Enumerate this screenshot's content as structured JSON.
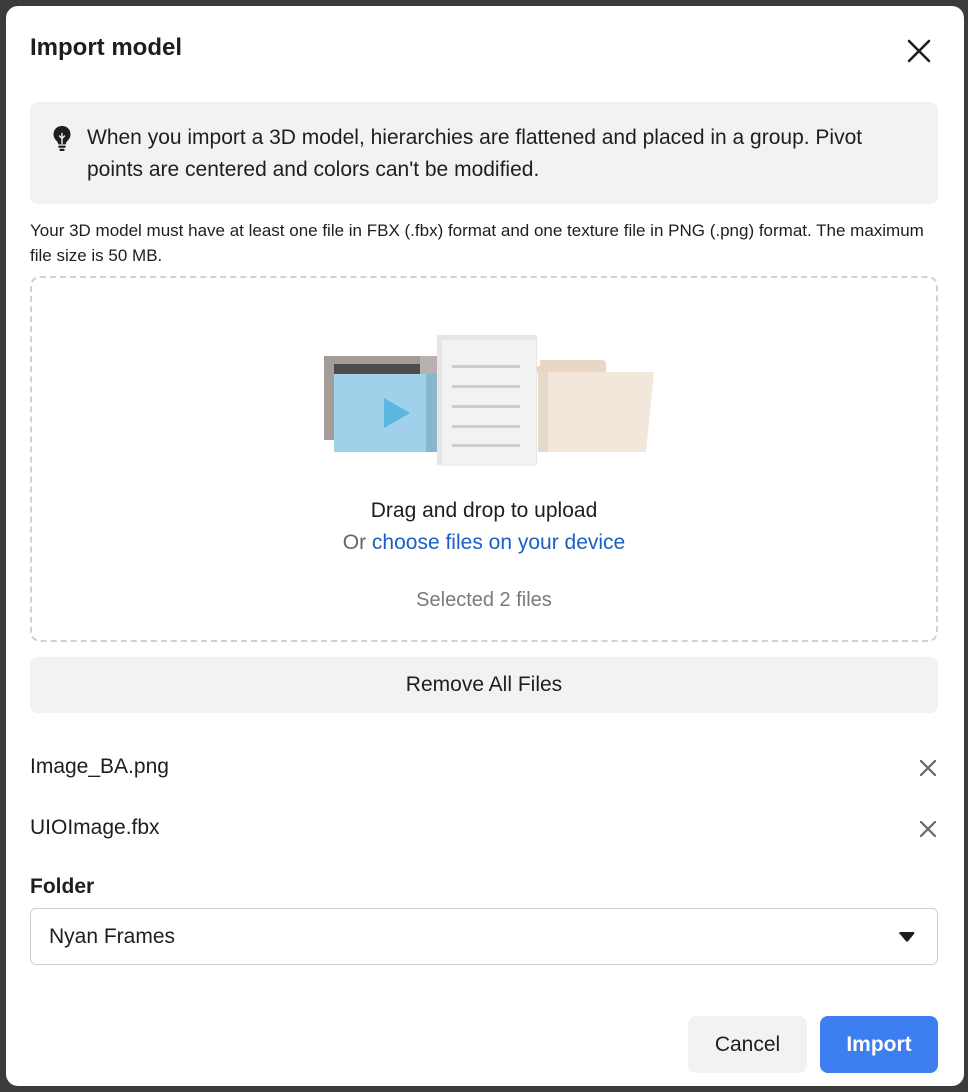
{
  "dialog": {
    "title": "Import model",
    "close_icon": "close-icon"
  },
  "info": {
    "icon": "lightbulb-icon",
    "text": "When you import a 3D model, hierarchies are flattened and placed in a group. Pivot points are centered and colors can't be modified."
  },
  "requirements": {
    "text": "Your 3D model must have at least one file in FBX (.fbx) format and one texture file in PNG (.png) format. The maximum file size is 50 MB."
  },
  "dropzone": {
    "illustration_icon": "upload-illustration",
    "drag_text": "Drag and drop to upload",
    "or_text": "Or ",
    "choose_link": "choose files on your device",
    "selected_text": "Selected 2 files"
  },
  "remove_all_label": "Remove All Files",
  "files": [
    {
      "name": "Image_BA.png"
    },
    {
      "name": "UIOImage.fbx"
    }
  ],
  "folder": {
    "label": "Folder",
    "selected": "Nyan Frames",
    "caret_icon": "caret-down-icon"
  },
  "footer": {
    "cancel_label": "Cancel",
    "import_label": "Import"
  },
  "colors": {
    "primary": "#3d7ff0",
    "link": "#1b5fc4",
    "surface": "#f2f2f2",
    "text": "#1c1e21"
  }
}
